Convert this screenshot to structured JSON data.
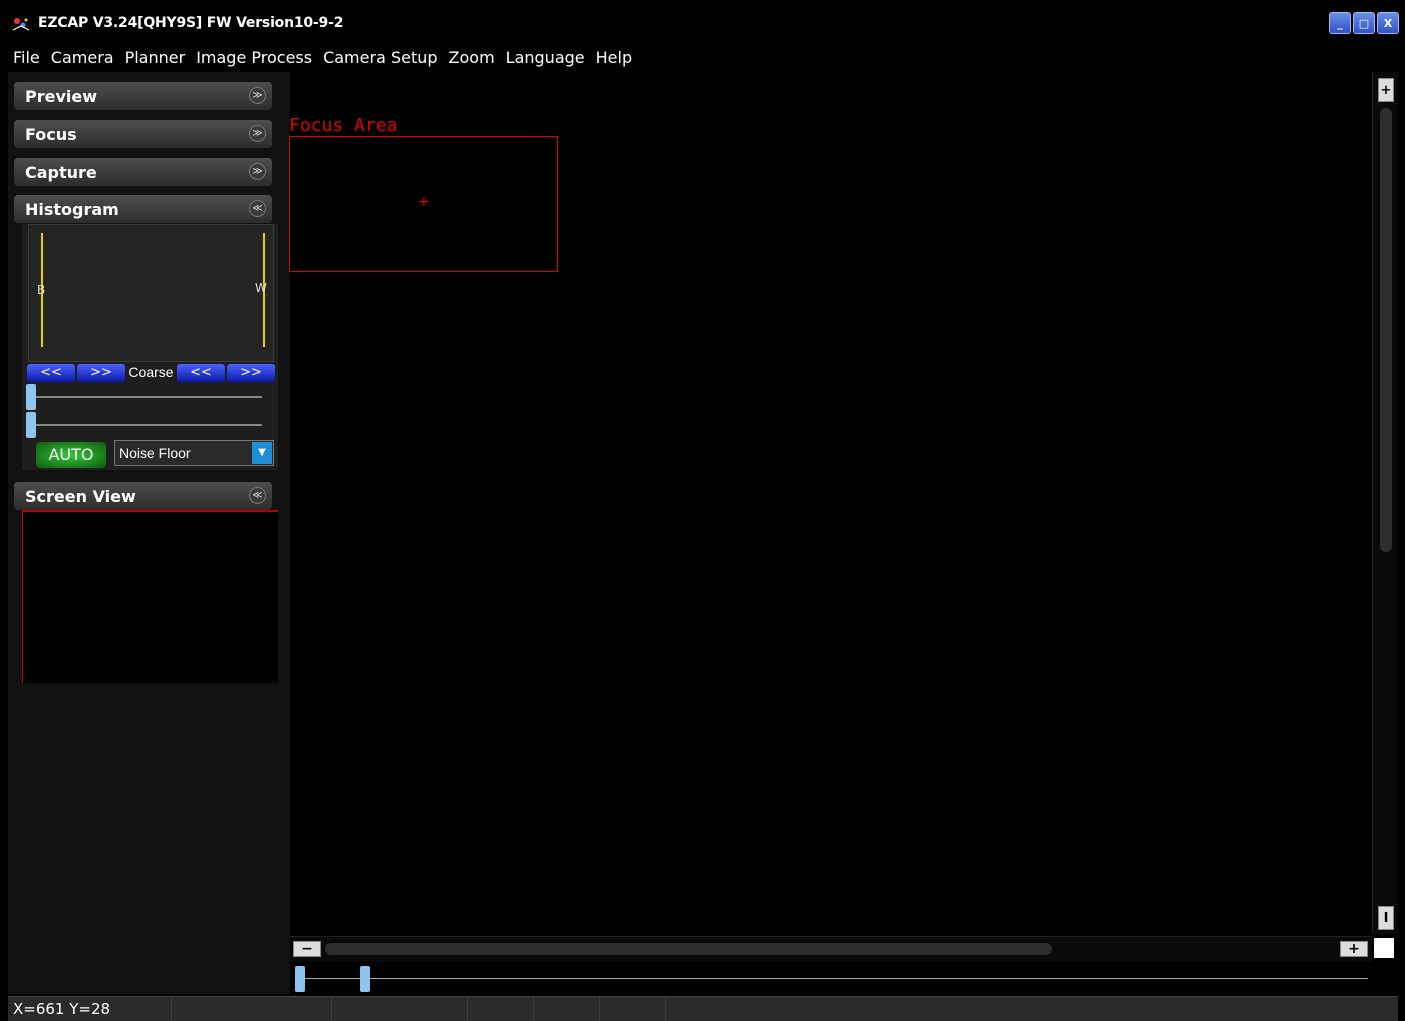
{
  "window": {
    "title": "EZCAP V3.24[QHY9S] FW Version10-9-2",
    "buttons": {
      "minimize": "_",
      "maximize": "□",
      "close": "X"
    }
  },
  "menu": [
    "File",
    "Camera",
    "Planner",
    "Image Process",
    "Camera Setup",
    "Zoom",
    "Language",
    "Help"
  ],
  "panels": {
    "preview": {
      "label": "Preview",
      "state": "collapsed"
    },
    "focus": {
      "label": "Focus",
      "state": "collapsed"
    },
    "capture": {
      "label": "Capture",
      "state": "collapsed"
    },
    "histogram": {
      "label": "Histogram",
      "state": "expanded",
      "black_label": "B",
      "white_label": "W",
      "buttons": [
        "<<",
        ">>",
        "Coarse",
        "<<",
        ">>"
      ],
      "auto_label": "AUTO",
      "mode_select": "Noise Floor"
    },
    "screen_view": {
      "label": "Screen View",
      "state": "expanded"
    }
  },
  "icons": {
    "collapsed": "≫",
    "expanded": "≪"
  },
  "main": {
    "focus_area_label": "Focus Area",
    "crosshair": "+"
  },
  "scrollbars": {
    "plus": "+",
    "minus": "−"
  },
  "status": {
    "coords": "X=661 Y=28"
  },
  "colors": {
    "focus_red": "#e00000",
    "histogram_line": "#e6d000",
    "button_blue": "#0b1aa3",
    "auto_green": "#36c73a",
    "dropdown_arrow": "#1d8fd4",
    "slider_thumb": "#8fc4ef"
  }
}
